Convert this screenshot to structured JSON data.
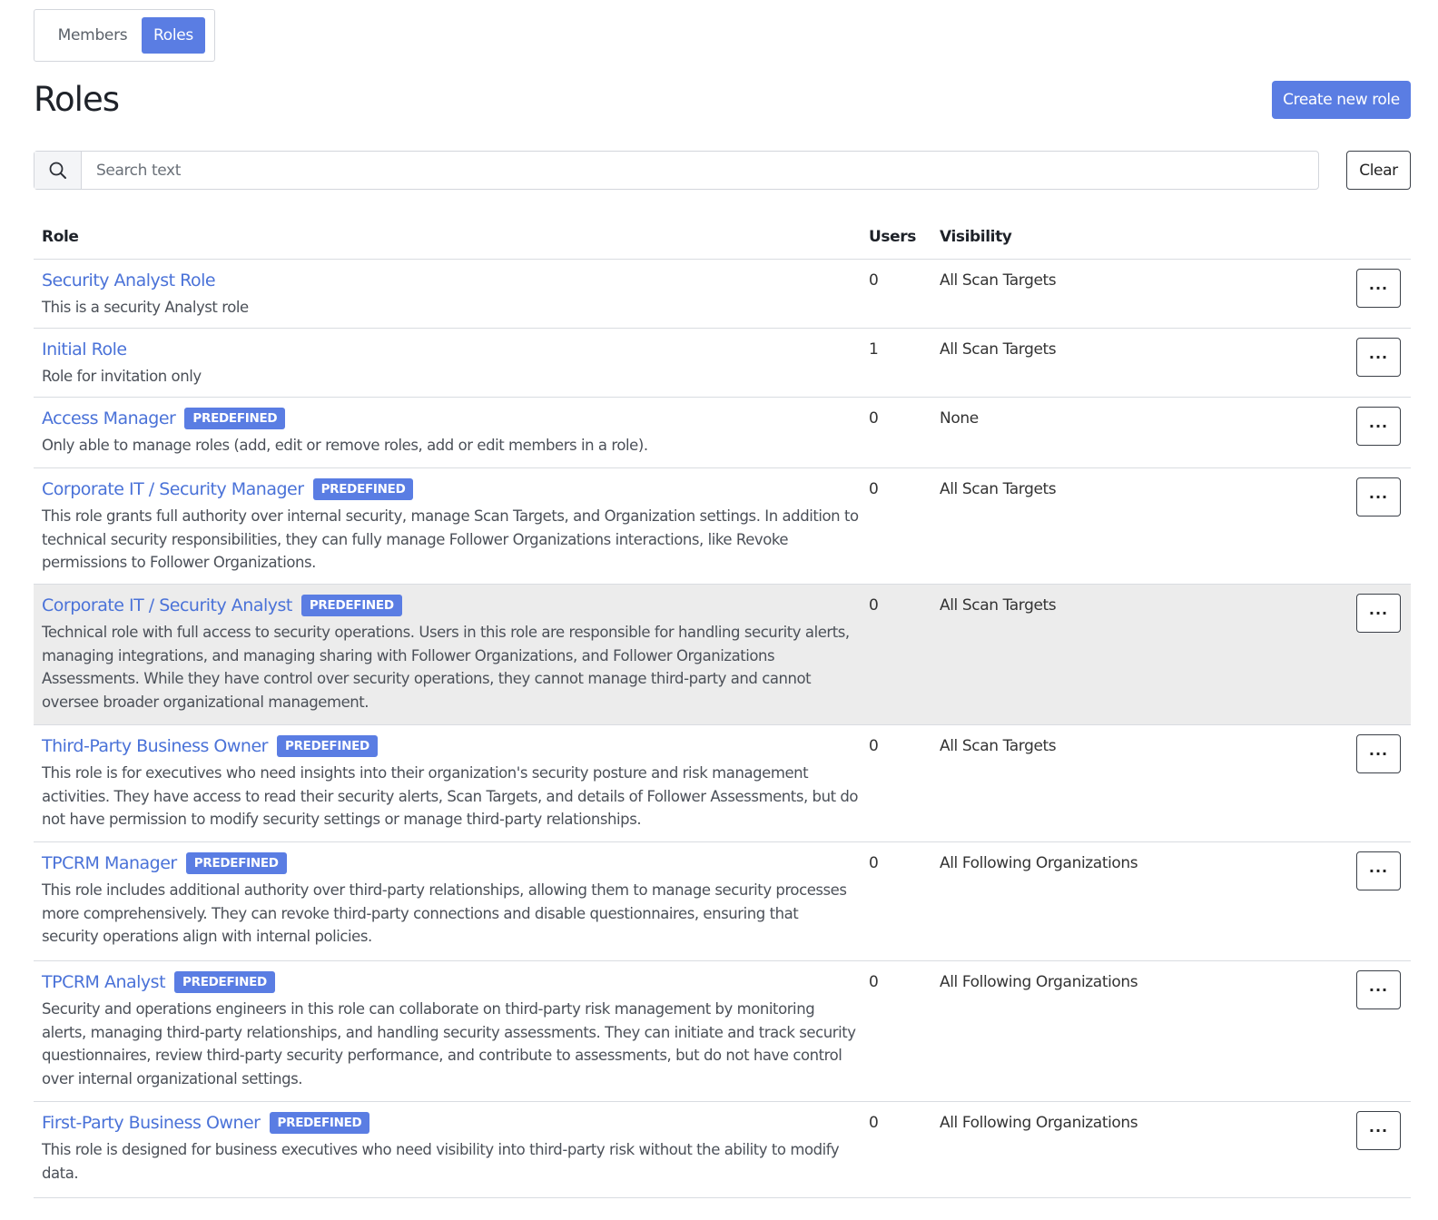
{
  "tabs": {
    "members": "Members",
    "roles": "Roles"
  },
  "header": {
    "title": "Roles",
    "create_label": "Create new role"
  },
  "search": {
    "placeholder": "Search text",
    "value": "",
    "clear_label": "Clear"
  },
  "table": {
    "columns": {
      "role": "Role",
      "users": "Users",
      "visibility": "Visibility"
    },
    "more_label": "···",
    "rows": [
      {
        "name": "Security Analyst Role",
        "badge": "",
        "desc": "This is a security Analyst role",
        "users": "0",
        "visibility": "All Scan Targets"
      },
      {
        "name": "Initial Role",
        "badge": "",
        "desc": "Role for invitation only",
        "users": "1",
        "visibility": "All Scan Targets"
      },
      {
        "name": "Access Manager",
        "badge": "PREDEFINED",
        "desc": "Only able to manage roles (add, edit or remove roles, add or edit members in a role).",
        "users": "0",
        "visibility": "None"
      },
      {
        "name": "Corporate IT / Security Manager",
        "badge": "PREDEFINED",
        "desc": "This role grants full authority over internal security, manage Scan Targets, and Organization settings. In addition to technical security responsibilities, they can fully manage Follower Organizations interactions, like Revoke permissions to Follower Organizations.",
        "users": "0",
        "visibility": "All Scan Targets"
      },
      {
        "name": "Corporate IT / Security Analyst",
        "badge": "PREDEFINED",
        "desc": "Technical role with full access to security operations. Users in this role are responsible for handling security alerts, managing integrations, and managing sharing with Follower Organizations, and Follower Organizations Assessments. While they have control over security operations, they cannot manage third-party and cannot oversee broader organizational management.",
        "users": "0",
        "visibility": "All Scan Targets"
      },
      {
        "name": "Third-Party Business Owner",
        "badge": "PREDEFINED",
        "desc": "This role is for executives who need insights into their organization's security posture and risk management activities. They have access to read their security alerts, Scan Targets, and details of Follower Assessments, but do not have permission to modify security settings or manage third-party relationships.",
        "users": "0",
        "visibility": "All Scan Targets"
      },
      {
        "name": "TPCRM Manager",
        "badge": "PREDEFINED",
        "desc": "This role includes additional authority over third-party relationships, allowing them to manage security processes more comprehensively. They can revoke third-party connections and disable questionnaires, ensuring that security operations align with internal policies.",
        "users": "0",
        "visibility": "All Following Organizations"
      },
      {
        "name": "TPCRM Analyst",
        "badge": "PREDEFINED",
        "desc": "Security and operations engineers in this role can collaborate on third-party risk management by monitoring alerts, managing third-party relationships, and handling security assessments. They can initiate and track security questionnaires, review third-party security performance, and contribute to assessments, but do not have control over internal organizational settings.",
        "users": "0",
        "visibility": "All Following Organizations"
      },
      {
        "name": "First-Party Business Owner",
        "badge": "PREDEFINED",
        "desc": "This role is designed for business executives who need visibility into third-party risk without the ability to modify data.",
        "users": "0",
        "visibility": "All Following Organizations"
      }
    ]
  },
  "colors": {
    "accent": "#5a7de3",
    "link": "#4a72d8",
    "highlight_row": "#ececec"
  }
}
